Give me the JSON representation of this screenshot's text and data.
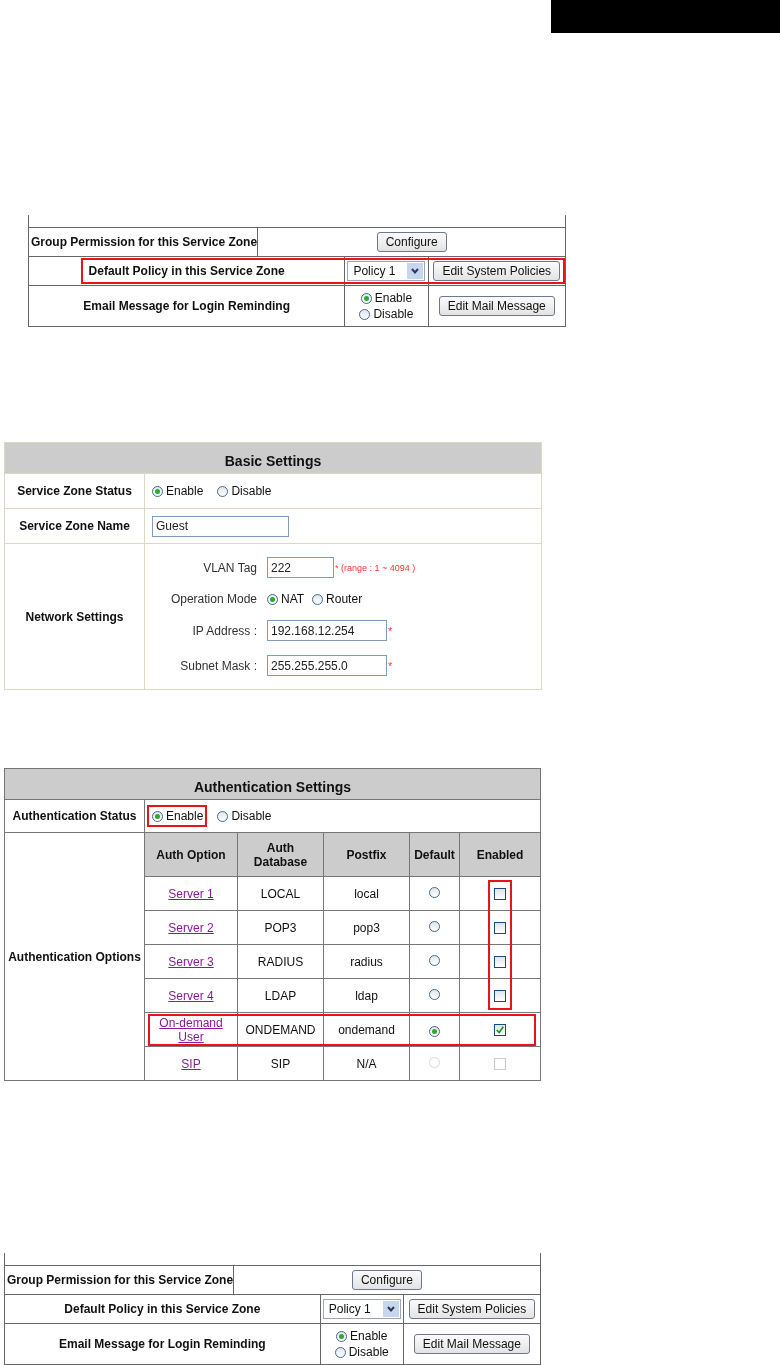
{
  "sections": [
    {
      "kind": "policy",
      "group_permission": {
        "label": "Group Permission for this Service Zone",
        "button": "Configure"
      },
      "default_policy": {
        "label": "Default Policy in this Service Zone",
        "select_value": "Policy 1",
        "button": "Edit System Policies",
        "highlighted": true
      },
      "email_message": {
        "label": "Email Message for Login Reminding",
        "options": [
          {
            "label": "Enable",
            "selected": true
          },
          {
            "label": "Disable",
            "selected": false
          }
        ],
        "button": "Edit Mail Message"
      }
    },
    {
      "kind": "basic",
      "title": "Basic Settings",
      "status": {
        "label": "Service Zone Status",
        "options": [
          {
            "label": "Enable",
            "selected": true
          },
          {
            "label": "Disable",
            "selected": false
          }
        ]
      },
      "name": {
        "label": "Service Zone Name",
        "value": "Guest"
      },
      "network": {
        "label": "Network Settings",
        "fields": [
          {
            "kind": "text",
            "label": "VLAN Tag",
            "value": "222",
            "note": "* (range : 1 ~ 4094 )"
          },
          {
            "kind": "radio",
            "label": "Operation Mode",
            "options": [
              {
                "label": "NAT",
                "selected": true
              },
              {
                "label": "Router",
                "selected": false
              }
            ]
          },
          {
            "kind": "text",
            "label": "IP Address :",
            "value": "192.168.12.254",
            "note": "*"
          },
          {
            "kind": "text",
            "label": "Subnet Mask :",
            "value": "255.255.255.0",
            "note": "*"
          }
        ]
      }
    },
    {
      "kind": "auth",
      "title": "Authentication Settings",
      "status": {
        "label": "Authentication Status",
        "options": [
          {
            "label": "Enable",
            "selected": true,
            "highlighted": true
          },
          {
            "label": "Disable",
            "selected": false,
            "highlighted": false
          }
        ]
      },
      "options": {
        "label": "Authentication Options",
        "columns": [
          "Auth Option",
          "Auth Database",
          "Postfix",
          "Default",
          "Enabled"
        ],
        "rows": [
          {
            "option": "Server 1",
            "database": "LOCAL",
            "postfix": "local",
            "default": false,
            "enabled": false,
            "disabled": false,
            "enabled_highlighted": true,
            "highlighted": false
          },
          {
            "option": "Server 2",
            "database": "POP3",
            "postfix": "pop3",
            "default": false,
            "enabled": false,
            "disabled": false,
            "enabled_highlighted": true,
            "highlighted": false
          },
          {
            "option": "Server 3",
            "database": "RADIUS",
            "postfix": "radius",
            "default": false,
            "enabled": false,
            "disabled": false,
            "enabled_highlighted": true,
            "highlighted": false
          },
          {
            "option": "Server 4",
            "database": "LDAP",
            "postfix": "ldap",
            "default": false,
            "enabled": false,
            "disabled": false,
            "enabled_highlighted": true,
            "highlighted": false
          },
          {
            "option": "On-demand User",
            "database": "ONDEMAND",
            "postfix": "ondemand",
            "default": true,
            "enabled": true,
            "disabled": false,
            "enabled_highlighted": false,
            "highlighted": true
          },
          {
            "option": "SIP",
            "database": "SIP",
            "postfix": "N/A",
            "default": false,
            "enabled": false,
            "disabled": true,
            "enabled_highlighted": false,
            "highlighted": false
          }
        ]
      }
    },
    {
      "kind": "policy",
      "group_permission": {
        "label": "Group Permission for this Service Zone",
        "button": "Configure"
      },
      "default_policy": {
        "label": "Default Policy in this Service Zone",
        "select_value": "Policy 1",
        "button": "Edit System Policies",
        "highlighted": false
      },
      "email_message": {
        "label": "Email Message for Login Reminding",
        "options": [
          {
            "label": "Enable",
            "selected": true
          },
          {
            "label": "Disable",
            "selected": false
          }
        ],
        "button": "Edit Mail Message"
      }
    }
  ]
}
